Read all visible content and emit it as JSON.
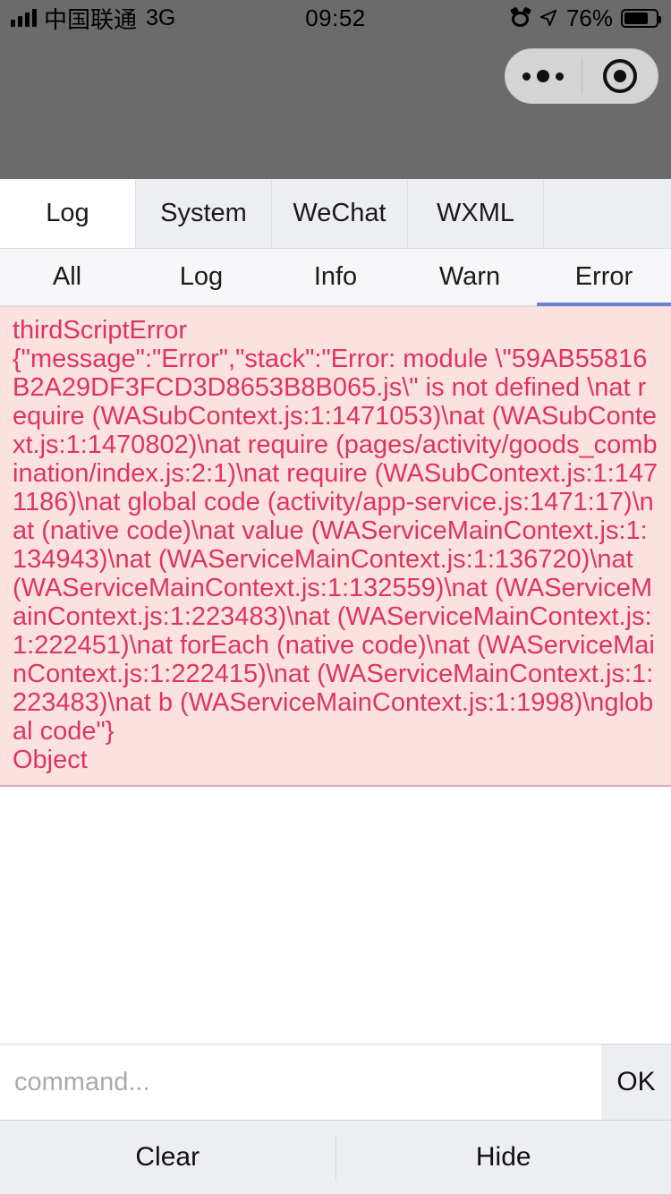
{
  "status_bar": {
    "carrier": "中国联通",
    "network": "3G",
    "time": "09:52",
    "battery_percent": "76%",
    "signal_icon": "signal-bars-icon",
    "alarm_icon": "alarm-clock-icon",
    "location_icon": "location-arrow-icon",
    "battery_icon": "battery-icon"
  },
  "capsule": {
    "more_icon": "more-dots-icon",
    "close_icon": "target-circle-icon"
  },
  "tabs": [
    {
      "label": "Log",
      "active": true
    },
    {
      "label": "System",
      "active": false
    },
    {
      "label": "WeChat",
      "active": false
    },
    {
      "label": "WXML",
      "active": false
    }
  ],
  "filters": [
    {
      "label": "All",
      "active": false
    },
    {
      "label": "Log",
      "active": false
    },
    {
      "label": "Info",
      "active": false
    },
    {
      "label": "Warn",
      "active": false
    },
    {
      "label": "Error",
      "active": true
    }
  ],
  "log": {
    "entries": [
      {
        "level": "thirdScriptError",
        "detail": "{\"message\":\"Error\",\"stack\":\"Error: module \\\"59AB55816B2A29DF3FCD3D8653B8B065.js\\\" is not defined \\nat require (WASubContext.js:1:1471053)\\nat (WASubContext.js:1:1470802)\\nat require (pages/activity/goods_combination/index.js:2:1)\\nat require (WASubContext.js:1:1471186)\\nat global code (activity/app-service.js:1471:17)\\nat (native code)\\nat value (WAServiceMainContext.js:1:134943)\\nat (WAServiceMainContext.js:1:136720)\\nat (WAServiceMainContext.js:1:132559)\\nat (WAServiceMainContext.js:1:223483)\\nat (WAServiceMainContext.js:1:222451)\\nat forEach (native code)\\nat (WAServiceMainContext.js:1:222415)\\nat (WAServiceMainContext.js:1:223483)\\nat b (WAServiceMainContext.js:1:1998)\\nglobal code\"}\nObject"
      }
    ]
  },
  "command_bar": {
    "placeholder": "command...",
    "value": "",
    "ok_label": "OK"
  },
  "footer": {
    "clear_label": "Clear",
    "hide_label": "Hide"
  },
  "colors": {
    "header_gray": "#6b6b6b",
    "error_bg": "#fbe2e0",
    "error_text": "#de355e",
    "accent_underline": "#6d7fd4",
    "tabbar_bg": "#eceef2"
  }
}
